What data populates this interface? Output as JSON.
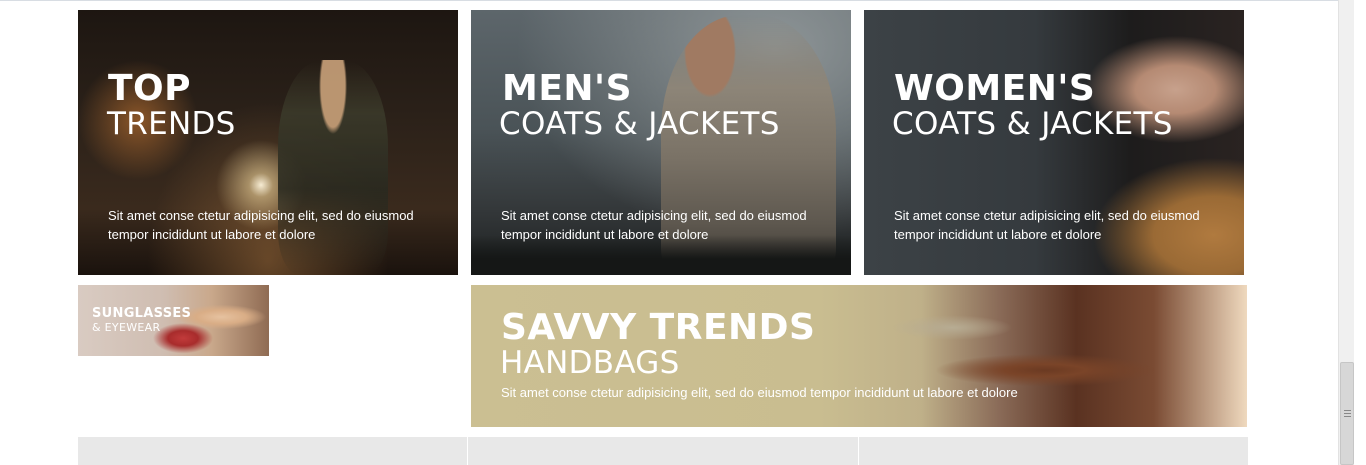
{
  "banners": {
    "top_trends": {
      "title": "TOP",
      "subtitle": "TRENDS",
      "description": "Sit amet conse ctetur adipisicing elit, sed do eiusmod tempor incididunt ut labore et dolore"
    },
    "mens": {
      "title": "MEN'S",
      "subtitle": "COATS & JACKETS",
      "description": "Sit amet conse ctetur adipisicing elit, sed do eiusmod tempor incididunt ut labore et dolore"
    },
    "womens": {
      "title": "WOMEN'S",
      "subtitle": "COATS & JACKETS",
      "description": "Sit amet conse ctetur adipisicing elit, sed do eiusmod tempor incididunt ut labore et dolore"
    },
    "sunglasses": {
      "title": "SUNGLASSES",
      "subtitle": "& EYEWEAR"
    },
    "savvy": {
      "title": "SAVVY TRENDS",
      "subtitle": "HANDBAGS",
      "description": "Sit amet conse ctetur adipisicing elit, sed do eiusmod tempor incididunt ut labore et dolore"
    }
  },
  "colors": {
    "text": "#ffffff",
    "bottom_row": "#e8e8e8",
    "scrollbar_track": "#f0f0f0",
    "scrollbar_thumb": "#d7d7d7"
  },
  "icons": {
    "scroll_grip": "grip-icon"
  }
}
